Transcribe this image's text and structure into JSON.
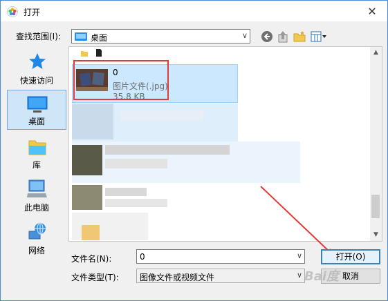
{
  "window": {
    "title": "打开",
    "close_glyph": "✕"
  },
  "toolbar": {
    "look_in_label": "查找范围(I):",
    "location": "桌面"
  },
  "places": [
    {
      "label": "快速访问",
      "icon": "star-icon"
    },
    {
      "label": "桌面",
      "icon": "desktop-icon",
      "active": true
    },
    {
      "label": "库",
      "icon": "library-icon"
    },
    {
      "label": "此电脑",
      "icon": "computer-icon"
    },
    {
      "label": "网络",
      "icon": "network-icon"
    }
  ],
  "file_list": {
    "selected": {
      "name": "0",
      "type": "图片文件(.jpg)",
      "size": "35.8 KB"
    }
  },
  "footer": {
    "filename_label": "文件名(N):",
    "filename_value": "0",
    "filetype_label": "文件类型(T):",
    "filetype_value": "图像文件或视频文件",
    "open_label": "打开(O)",
    "cancel_label": "取消"
  },
  "watermark": "Bai度"
}
